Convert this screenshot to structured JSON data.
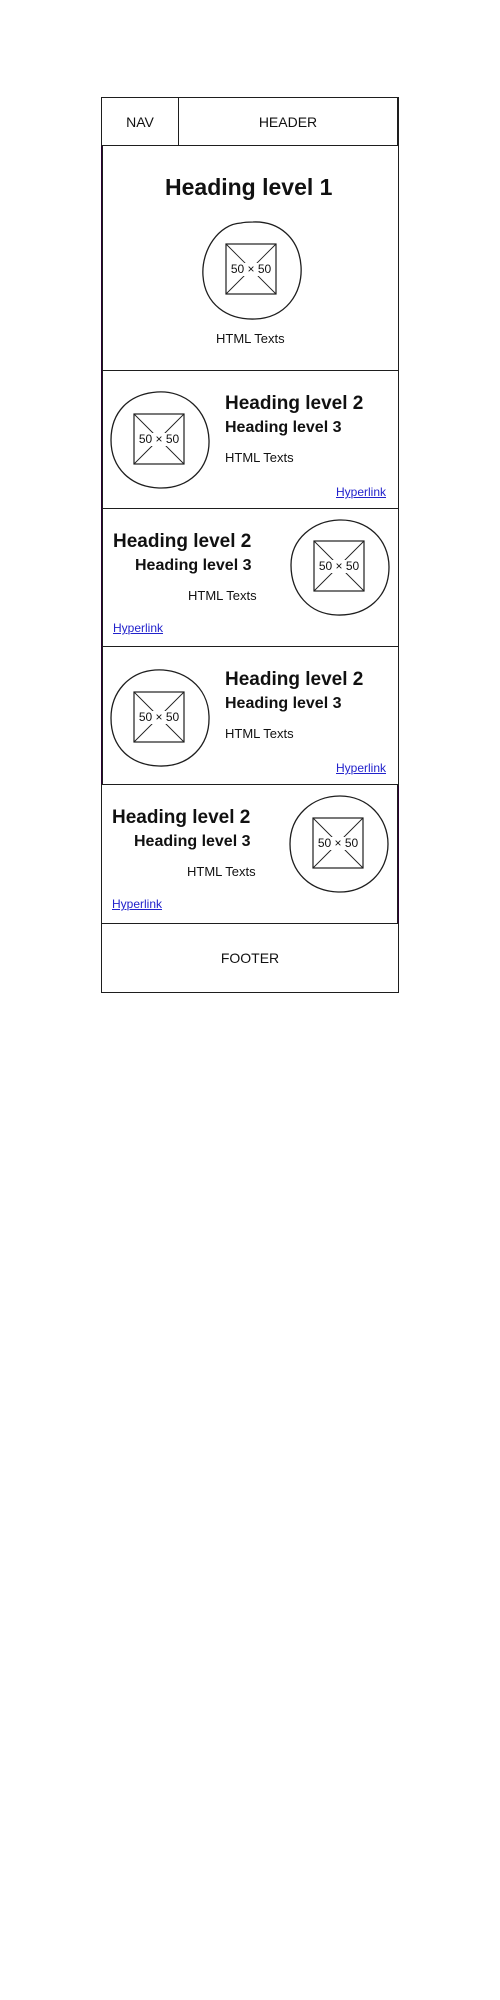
{
  "nav": {
    "label": "NAV"
  },
  "header": {
    "label": "HEADER"
  },
  "footer": {
    "label": "FOOTER"
  },
  "hero": {
    "heading": "Heading level 1",
    "image_label": "50 × 50",
    "text": "HTML Texts"
  },
  "sections": [
    {
      "h2": "Heading level 2",
      "h3": "Heading level 3",
      "text": "HTML Texts",
      "link": "Hyperlink",
      "image_label": "50 × 50"
    },
    {
      "h2": "Heading level 2",
      "h3": "Heading level 3",
      "text": "HTML Texts",
      "link": "Hyperlink",
      "image_label": "50 × 50"
    },
    {
      "h2": "Heading level 2",
      "h3": "Heading level 3",
      "text": "HTML Texts",
      "link": "Hyperlink",
      "image_label": "50 × 50"
    },
    {
      "h2": "Heading level 2",
      "h3": "Heading level 3",
      "text": "HTML Texts",
      "link": "Hyperlink",
      "image_label": "50 × 50"
    }
  ],
  "colors": {
    "frame": "#2a0033",
    "border": "#1e1e1e",
    "link": "#2222cc"
  }
}
